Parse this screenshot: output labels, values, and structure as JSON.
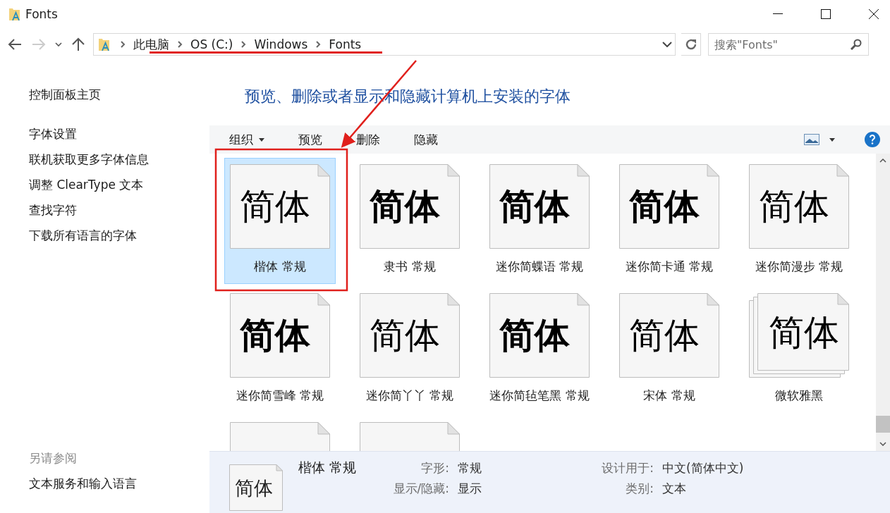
{
  "window": {
    "title": "Fonts"
  },
  "address_bar": {
    "path": [
      "此电脑",
      "OS (C:)",
      "Windows",
      "Fonts"
    ]
  },
  "search": {
    "placeholder": "搜索\"Fonts\""
  },
  "sidebar": {
    "items": [
      {
        "label": "控制面板主页",
        "kind": "home"
      },
      {
        "label": "字体设置",
        "kind": "link"
      },
      {
        "label": "联机获取更多字体信息",
        "kind": "link"
      },
      {
        "label": "调整 ClearType 文本",
        "kind": "link"
      },
      {
        "label": "查找字符",
        "kind": "link"
      },
      {
        "label": "下载所有语言的字体",
        "kind": "link"
      }
    ],
    "see_also": {
      "heading": "另请参阅",
      "items": [
        "文本服务和输入语言"
      ]
    }
  },
  "heading": "预览、删除或者显示和隐藏计算机上安装的字体",
  "toolbar": {
    "items": [
      {
        "label": "组织",
        "dropdown": true
      },
      {
        "label": "预览",
        "dropdown": false
      },
      {
        "label": "删除",
        "dropdown": false
      },
      {
        "label": "隐藏",
        "dropdown": false
      }
    ]
  },
  "tiles": [
    {
      "kind": "page",
      "sample": "简体",
      "label": "楷体 常规",
      "selected": true
    },
    {
      "kind": "page",
      "sample": "简体",
      "label": "隶书 常规",
      "selected": false
    },
    {
      "kind": "page",
      "sample": "简体",
      "label": "迷你简蝶语 常规",
      "selected": false
    },
    {
      "kind": "page",
      "sample": "简体",
      "label": "迷你简卡通 常规",
      "selected": false
    },
    {
      "kind": "page",
      "sample": "简体",
      "label": "迷你简漫步 常规",
      "selected": false
    },
    {
      "kind": "page",
      "sample": "简体",
      "label": "迷你简雪峰 常规",
      "selected": false
    },
    {
      "kind": "page",
      "sample": "简体",
      "label": "迷你简丫丫 常规",
      "selected": false
    },
    {
      "kind": "page",
      "sample": "简体",
      "label": "迷你简毡笔黑 常规",
      "selected": false
    },
    {
      "kind": "page",
      "sample": "简体",
      "label": "宋体 常规",
      "selected": false
    },
    {
      "kind": "family",
      "sample": "简体",
      "label": "微软雅黑",
      "selected": false
    },
    {
      "kind": "blank"
    },
    {
      "kind": "blank"
    }
  ],
  "details": {
    "sample": "简体",
    "name": "楷体 常规",
    "fields": [
      {
        "label": "字形:",
        "value": "常规"
      },
      {
        "label": "设计用于:",
        "value": "中文(简体中文)"
      },
      {
        "label": "显示/隐藏:",
        "value": "显示"
      },
      {
        "label": "类别:",
        "value": "文本"
      }
    ]
  }
}
